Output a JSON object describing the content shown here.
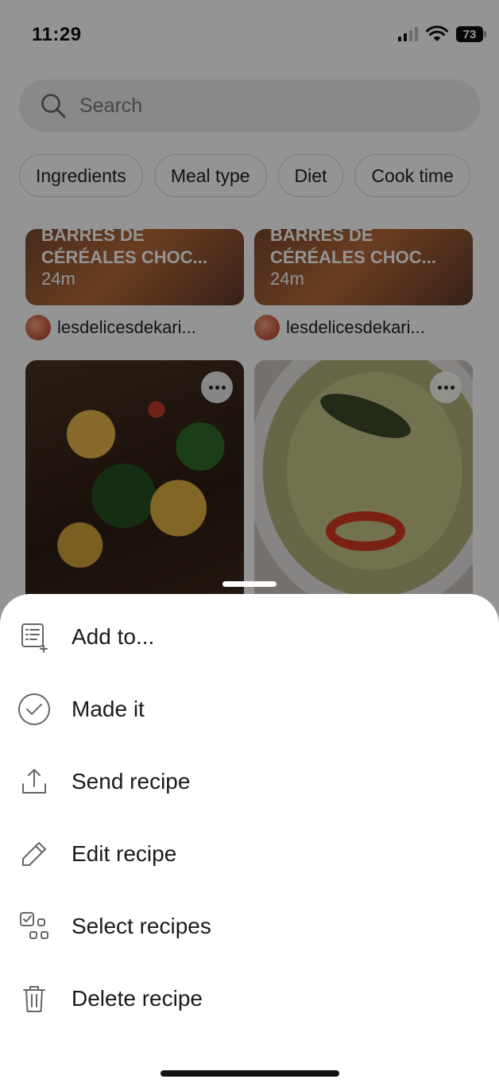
{
  "status": {
    "time": "11:29",
    "battery": "73"
  },
  "search": {
    "placeholder": "Search"
  },
  "filters": [
    "Ingredients",
    "Meal type",
    "Diet",
    "Cook time"
  ],
  "recipes_top": [
    {
      "title_line1": "BARRES DE",
      "title_line2": "CÉRÉALES CHOC...",
      "duration": "24m",
      "author": "lesdelicesdekari..."
    },
    {
      "title_line1": "BARRES DE",
      "title_line2": "CÉRÉALES CHOC...",
      "duration": "24m",
      "author": "lesdelicesdekari..."
    }
  ],
  "menu": [
    {
      "label": "Add to...",
      "icon": "list-add-icon"
    },
    {
      "label": "Made it",
      "icon": "check-circle-icon"
    },
    {
      "label": "Send recipe",
      "icon": "share-icon"
    },
    {
      "label": "Edit recipe",
      "icon": "pencil-icon"
    },
    {
      "label": "Select recipes",
      "icon": "select-grid-icon"
    },
    {
      "label": "Delete recipe",
      "icon": "trash-icon"
    }
  ]
}
